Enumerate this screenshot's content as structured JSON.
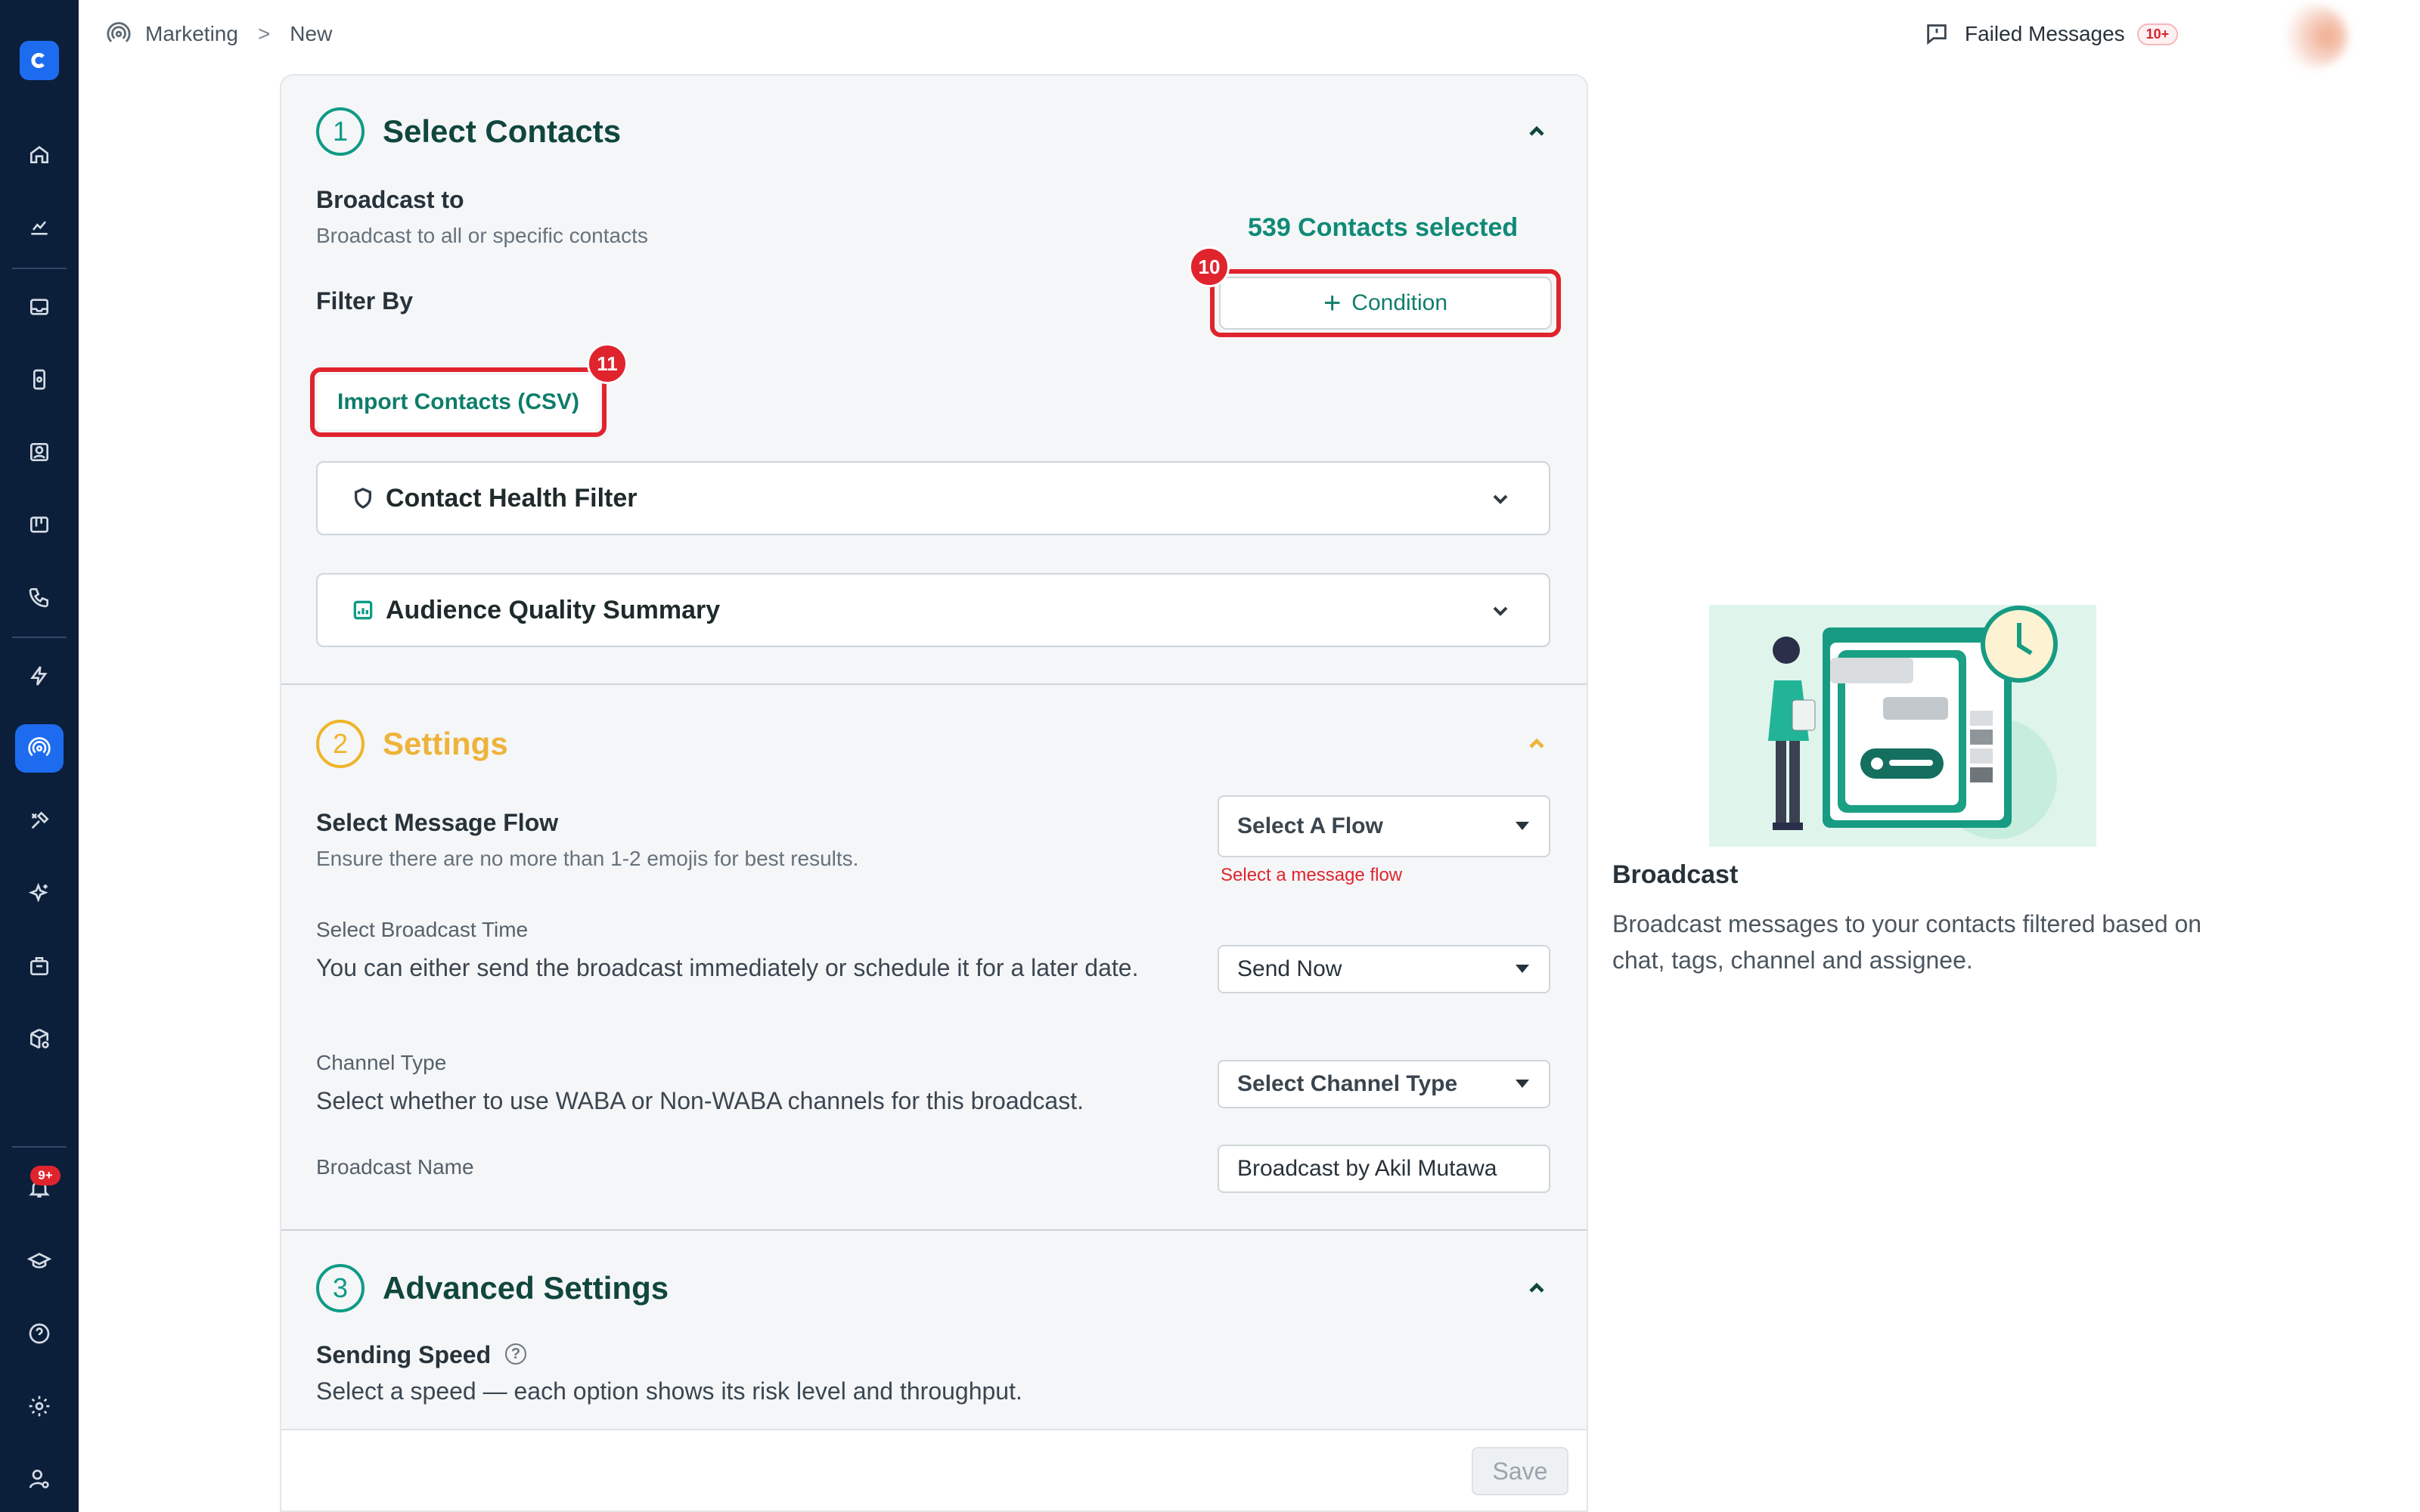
{
  "breadcrumb": {
    "section": "Marketing",
    "separator": ">",
    "current": "New"
  },
  "header": {
    "failed_label": "Failed Messages",
    "failed_badge": "10+"
  },
  "sidebar": {
    "notification_badge": "9+"
  },
  "select_contacts": {
    "step": "1",
    "title": "Select Contacts",
    "broadcast_to_label": "Broadcast to",
    "broadcast_to_desc": "Broadcast to all or specific contacts",
    "contacts_selected": "539 Contacts selected",
    "filter_by_label": "Filter By",
    "condition_button": "Condition",
    "import_button": "Import Contacts (CSV)",
    "health_filter": "Contact Health Filter",
    "audience_summary": "Audience Quality Summary"
  },
  "markers": {
    "condition": "10",
    "import": "11"
  },
  "settings": {
    "step": "2",
    "title": "Settings",
    "message_flow_label": "Select Message Flow",
    "message_flow_desc": "Ensure there are no more than 1-2 emojis for best results.",
    "message_flow_value": "Select A Flow",
    "message_flow_error": "Select a message flow",
    "time_label": "Select Broadcast Time",
    "time_desc": "You can either send the broadcast immediately or schedule it for a later date.",
    "time_value": "Send Now",
    "channel_label": "Channel Type",
    "channel_desc": "Select whether to use WABA or Non-WABA channels for this broadcast.",
    "channel_value": "Select Channel Type",
    "name_label": "Broadcast Name",
    "name_value": "Broadcast by Akil Mutawa"
  },
  "advanced": {
    "step": "3",
    "title": "Advanced Settings",
    "speed_label": "Sending Speed",
    "speed_desc": "Select a speed — each option shows its risk level and throughput."
  },
  "footer": {
    "save": "Save"
  },
  "info_panel": {
    "title": "Broadcast",
    "description": "Broadcast messages to your contacts filtered based on chat, tags, channel and assignee."
  },
  "colors": {
    "accent": "#0f9b86",
    "warning": "#f0b429",
    "error": "#e0242e",
    "sidebar": "#0b1f3a",
    "active": "#1d6cf0"
  }
}
